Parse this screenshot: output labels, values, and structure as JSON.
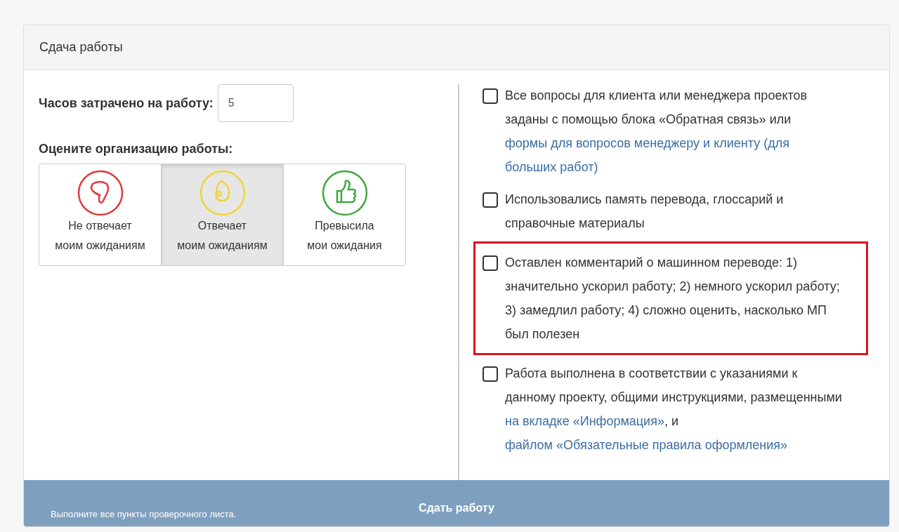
{
  "panel": {
    "title": "Сдача работы"
  },
  "hours": {
    "label": "Часов затрачено на работу:",
    "value": "5"
  },
  "rating": {
    "label": "Оцените организацию работы:",
    "options": [
      {
        "kind": "bad",
        "line1": "Не отвечает",
        "line2": "моим ожиданиям",
        "selected": false,
        "color": "#e0393b"
      },
      {
        "kind": "ok",
        "line1": "Отвечает",
        "line2": "моим ожиданиям",
        "selected": true,
        "color": "#f2d33a"
      },
      {
        "kind": "good",
        "line1": "Превысила",
        "line2": "мои ожидания",
        "selected": false,
        "color": "#3fa83f"
      }
    ]
  },
  "checklist": [
    {
      "checked": false,
      "highlighted": false,
      "parts": [
        {
          "kind": "text",
          "text": "Все вопросы для клиента или менеджера проектов заданы с помощью блока «Обратная связь» или "
        },
        {
          "kind": "link",
          "text": "формы для вопросов менеджеру и клиенту (для"
        },
        {
          "kind": "link",
          "text": "больших работ)"
        }
      ]
    },
    {
      "checked": false,
      "highlighted": false,
      "parts": [
        {
          "kind": "text",
          "text": "Использовались память перевода, глоссарий и справочные материалы"
        }
      ]
    },
    {
      "checked": false,
      "highlighted": true,
      "parts": [
        {
          "kind": "text",
          "text": "Оставлен комментарий о машинном переводе: 1) значительно ускорил работу; 2) немного ускорил работу; 3) замедлил работу; 4) сложно оценить, насколько МП был полезен"
        }
      ]
    },
    {
      "checked": false,
      "highlighted": false,
      "parts": [
        {
          "kind": "text",
          "text": "Работа выполнена в соответствии с указаниями к данному проекту, общими инструкциями, размещенными "
        },
        {
          "kind": "link",
          "text": "на вкладке «Информация»"
        },
        {
          "kind": "text",
          "text": ", и "
        },
        {
          "kind": "link",
          "text": "файлом «Обязательные правила оформления»"
        }
      ]
    }
  ],
  "submit": {
    "label": "Сдать работу",
    "hint": "Выполните все пункты проверочного листа.",
    "disabled": true
  }
}
